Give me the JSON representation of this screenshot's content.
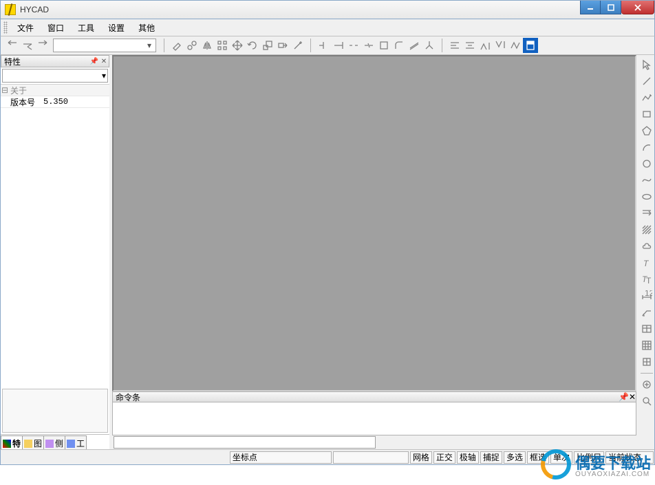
{
  "window": {
    "title": "HYCAD"
  },
  "menu": {
    "items": [
      "文件",
      "窗口",
      "工具",
      "设置",
      "其他"
    ]
  },
  "toolbar": {
    "layer_value": ""
  },
  "panels": {
    "left": {
      "title": "特性",
      "combo_value": "",
      "category": {
        "expand": "⊟",
        "label": "关于"
      },
      "rows": [
        {
          "k": "版本号",
          "v": "5.350"
        }
      ],
      "tabs": [
        {
          "label": "特",
          "active": true
        },
        {
          "label": "图"
        },
        {
          "label": "侧"
        },
        {
          "label": "工"
        }
      ]
    },
    "command": {
      "title": "命令条",
      "input_value": ""
    }
  },
  "right_tools": [
    "pointer-icon",
    "line-icon",
    "polyline-icon",
    "rectangle-icon",
    "polygon-icon",
    "arc-icon",
    "circle-icon",
    "spline-icon",
    "ellipse-icon",
    "ray-icon",
    "hatch-icon",
    "cloud-icon",
    "text-icon",
    "mtext-icon",
    "dimension-icon",
    "leader-icon",
    "table-icon",
    "grid-icon",
    "block-icon",
    "region-icon",
    "detail-icon",
    "sep"
  ],
  "status": {
    "coord_label": "坐标点",
    "coord_value": "",
    "toggles": [
      "网格",
      "正交",
      "极轴",
      "捕捉",
      "多选",
      "框选",
      "单次",
      "比例尺"
    ],
    "state_label": "当前状态"
  },
  "watermark": {
    "text": "偶要下载站",
    "sub": "OUYAOXIAZAI.COM"
  }
}
